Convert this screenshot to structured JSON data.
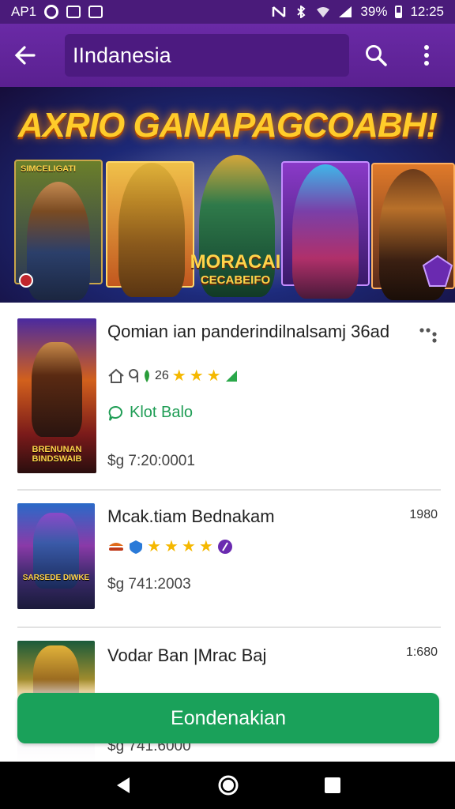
{
  "status_bar": {
    "carrier": "AP1",
    "battery": "39%",
    "time": "12:25"
  },
  "app_bar": {
    "search_value": "IIndanesia"
  },
  "banner": {
    "title": "AXRIO GANAPAGCOABH!",
    "logo_line1": "MORACAI",
    "logo_line2": "CECABEIFO",
    "card_tag": "SIMCELIGATI"
  },
  "list": {
    "items": [
      {
        "title": "Qomian ian panderindilnalsamj 36ad",
        "rating": "26",
        "status": "Klot Balo",
        "price": "$g 7:20:0001",
        "thumb_caption": "BRENUNAN BINDSWAIB"
      },
      {
        "title": "Mcak.tiam Bednakam",
        "price": "$g 741:2003",
        "right_value": "1980",
        "thumb_caption": "SARSEDE DIWKE"
      },
      {
        "title": "Vodar Ban |Mrac Baj",
        "price": "$g 741.6000",
        "right_value": "1:680"
      }
    ]
  },
  "action": {
    "button_label": "Eondenakian"
  },
  "colors": {
    "app_bar": "#5a2090",
    "accent_green": "#1aa15a",
    "star": "#f5b800"
  }
}
